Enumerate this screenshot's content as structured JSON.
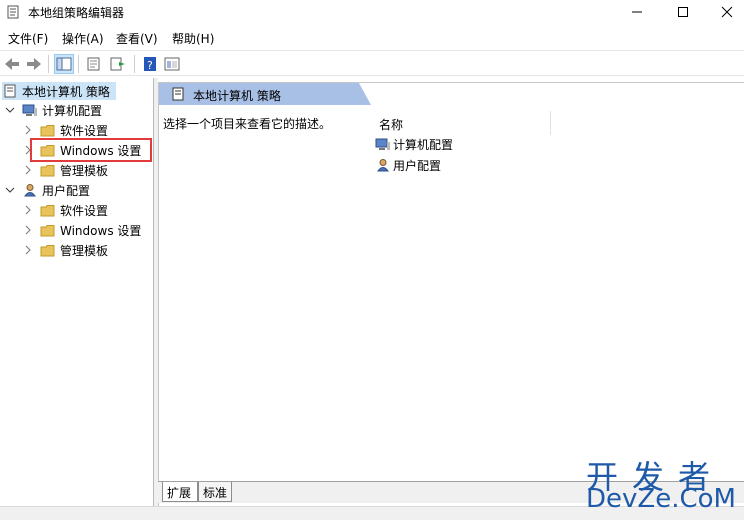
{
  "window": {
    "title": "本地组策略编辑器",
    "controls": {
      "minimize": "—",
      "maximize": "☐",
      "close": "✕"
    }
  },
  "menubar": {
    "items": [
      "文件(F)",
      "操作(A)",
      "查看(V)",
      "帮助(H)"
    ]
  },
  "toolbar": {
    "buttons": [
      "back-arrow-icon",
      "forward-arrow-icon",
      "show-hide-tree-icon",
      "properties-icon",
      "export-list-icon",
      "help-icon",
      "view-icon"
    ]
  },
  "tree": {
    "root": "本地计算机 策略",
    "computer_config": "计算机配置",
    "computer_children": [
      "软件设置",
      "Windows 设置",
      "管理模板"
    ],
    "user_config": "用户配置",
    "user_children": [
      "软件设置",
      "Windows 设置",
      "管理模板"
    ]
  },
  "right_pane": {
    "header_title": "本地计算机 策略",
    "description": "选择一个项目来查看它的描述。",
    "column_header": "名称",
    "items": [
      "计算机配置",
      "用户配置"
    ]
  },
  "tabs": [
    "扩展",
    "标准"
  ],
  "watermark": {
    "top": "开发者",
    "bottom": "DevZe.CoM"
  },
  "colors": {
    "selection": "#cce4f7",
    "header_bar": "#a9c0e6",
    "highlight_box": "#e23b3b",
    "folder": "#e8c25b",
    "watermark": "#1e5aa8"
  }
}
